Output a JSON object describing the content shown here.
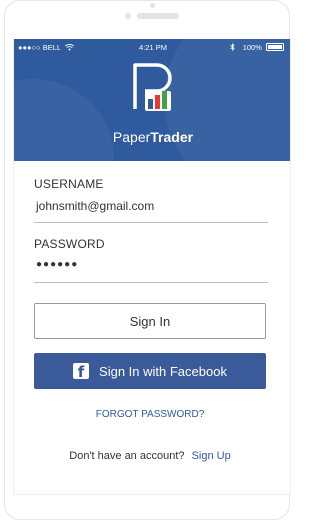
{
  "status_bar": {
    "carrier": "●●●○○ BELL",
    "wifi_icon": "wifi-icon",
    "time": "4:21 PM",
    "bluetooth_icon": "bluetooth-icon",
    "battery": "100%"
  },
  "brand": {
    "name_regular": "Paper",
    "name_bold": "Trader",
    "colors": {
      "header_bg": "#2f5a9e",
      "accent": "#2f5a9e",
      "facebook": "#3b5a9a"
    }
  },
  "form": {
    "username_label": "USERNAME",
    "username_value": "johnsmith@gmail.com",
    "password_label": "PASSWORD",
    "password_value": "●●●●●●",
    "signin_label": "Sign In",
    "facebook_label": "Sign In with Facebook",
    "forgot_label": "FORGOT PASSWORD?",
    "no_account_text": "Don't have an account?",
    "signup_label": "Sign Up"
  }
}
